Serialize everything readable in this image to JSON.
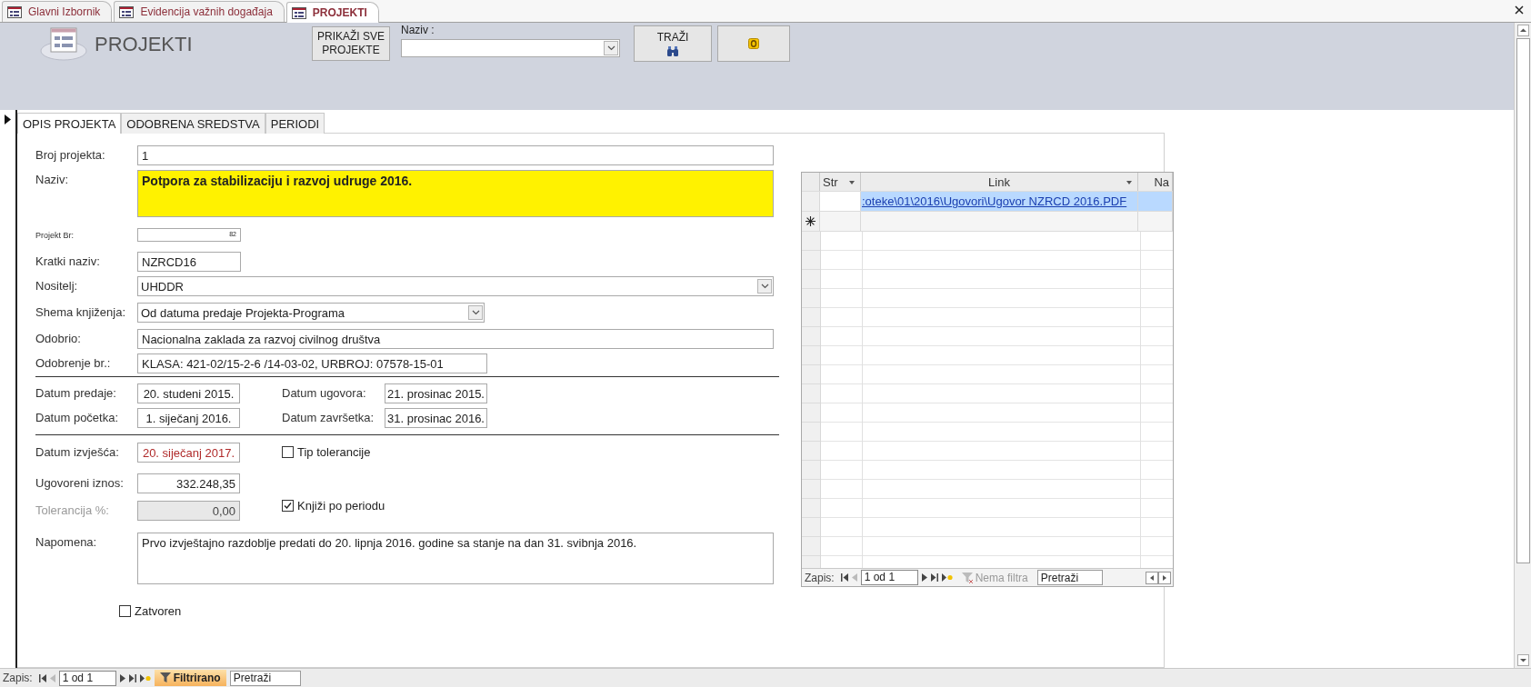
{
  "document_tabs": [
    {
      "label": "Glavni Izbornik",
      "selected": false
    },
    {
      "label": "Evidencija važnih događaja",
      "selected": false
    },
    {
      "label": "PROJEKTI",
      "selected": true
    }
  ],
  "header": {
    "title": "PROJEKTI",
    "show_all_button": "PRIKAŽI SVE PROJEKTE",
    "search_label": "Naziv :",
    "search_button": "TRAŽI"
  },
  "form_tabs": [
    {
      "label": "OPIS PROJEKTA",
      "selected": true
    },
    {
      "label": "ODOBRENA SREDSTVA",
      "selected": false
    },
    {
      "label": "PERIODI",
      "selected": false
    }
  ],
  "fields": [
    {
      "label": "Broj projekta:",
      "value": "1",
      "kind": "text"
    },
    {
      "label": "Naziv:",
      "value": "Potpora za stabilizaciju i razvoj udruge 2016.",
      "kind": "highlight"
    },
    {
      "label": "Projekt Br:",
      "value": "82",
      "kind": "tiny"
    },
    {
      "label": "Kratki naziv:",
      "value": "NZRCD16",
      "kind": "text"
    },
    {
      "label": "Nositelj:",
      "value": "UHDDR",
      "kind": "combo"
    },
    {
      "label": "Shema knjiženja:",
      "value": "Od datuma predaje Projekta-Programa",
      "kind": "combo"
    },
    {
      "label": "Odobrio:",
      "value": "Nacionalna zaklada za razvoj civilnog društva",
      "kind": "text"
    },
    {
      "label": "Odobrenje br.:",
      "value": "KLASA: 421-02/15-2-6 /14-03-02, URBROJ: 07578-15-01",
      "kind": "text"
    }
  ],
  "dates": [
    {
      "label": "Datum predaje:",
      "value": "20. studeni 2015."
    },
    {
      "label": "Datum ugovora:",
      "value": "21. prosinac 2015."
    },
    {
      "label": "Datum početka:",
      "value": "1. siječanj 2016."
    },
    {
      "label": "Datum završetka:",
      "value": "31. prosinac 2016."
    }
  ],
  "report_date": {
    "label": "Datum izvješća:",
    "value": "20. siječanj 2017.",
    "alert": true
  },
  "amounts": [
    {
      "label": "Ugovoreni iznos:",
      "value": "332.248,35",
      "disabled": false
    },
    {
      "label": "Tolerancija %:",
      "value": "0,00",
      "disabled": true
    }
  ],
  "checkboxes": [
    {
      "label": "Tip tolerancije",
      "checked": false
    },
    {
      "label": "Knjiži po periodu",
      "checked": true
    }
  ],
  "note": {
    "label": "Napomena:",
    "value": "Prvo izvještajno razdoblje predati do 20. lipnja 2016. godine sa stanje na dan 31. svibnja 2016."
  },
  "closed": {
    "label": "Zatvoren",
    "checked": false
  },
  "attachments": {
    "columns": [
      "Str",
      "Link",
      "Na"
    ],
    "rows": [
      {
        "link": ":oteke\\01\\2016\\Ugovori\\Ugovor NZRCD 2016.PDF",
        "selected": true
      }
    ],
    "nav": {
      "record_label": "Zapis:",
      "position": "1 od 1",
      "filter_label": "Nema filtra",
      "filtered": false,
      "search_placeholder": "Pretraži"
    }
  },
  "record_nav": {
    "record_label": "Zapis:",
    "position": "1 od 1",
    "filter_label": "Filtrirano",
    "filtered": true,
    "search_placeholder": "Pretraži"
  }
}
